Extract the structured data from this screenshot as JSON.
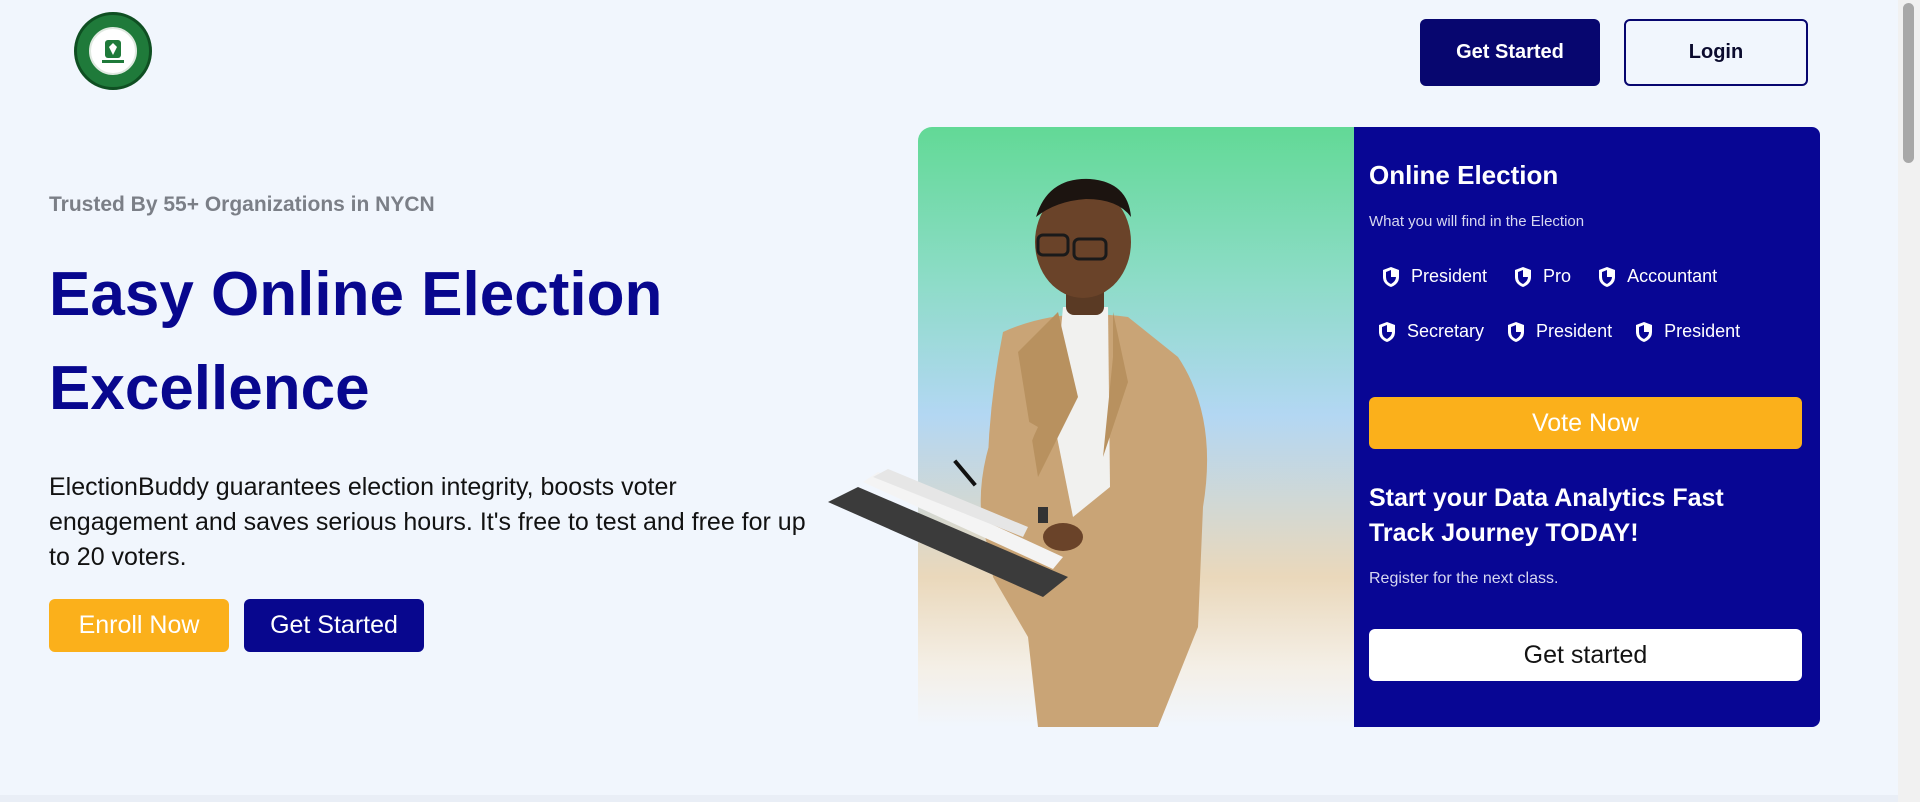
{
  "header": {
    "logo_text": "NATIONAL YOUTH COUNCIL OF NIGERIA · NYCN",
    "get_started_label": "Get Started",
    "login_label": "Login"
  },
  "hero": {
    "trusted": "Trusted By 55+ Organizations in NYCN",
    "headline_line1": "Easy Online Election",
    "headline_line2": "Excellence",
    "lead": "ElectionBuddy guarantees election integrity, boosts voter engagement and saves serious hours. It's free to test and free for up to 20 voters.",
    "enroll_label": "Enroll Now",
    "get_started_label": "Get Started"
  },
  "card": {
    "title": "Online Election",
    "subtitle": "What you will find in the Election",
    "positions": [
      "President",
      "Pro",
      "Accountant",
      "Secretary",
      "President",
      "President"
    ],
    "vote_label": "Vote Now",
    "promo_title": "Start your Data Analytics Fast Track Journey TODAY!",
    "promo_text": "Register for the next class.",
    "promo_button": "Get started"
  },
  "colors": {
    "brand_navy": "#08078e",
    "accent_yellow": "#fbb01b",
    "page_bg": "#f1f6fd"
  },
  "icons": {
    "position_icon": "shield-icon",
    "logo": "nycn-seal"
  }
}
